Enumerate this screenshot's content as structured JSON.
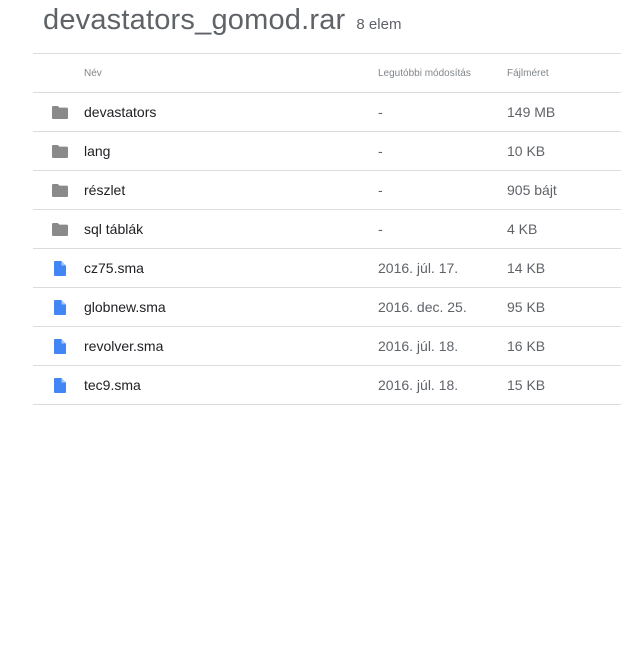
{
  "header": {
    "title": "devastators_gomod.rar",
    "count": "8 elem"
  },
  "columns": {
    "name": "Név",
    "modified": "Legutóbbi módosítás",
    "size": "Fájlméret"
  },
  "colors": {
    "folder_icon": "#8a8a8a",
    "file_icon": "#4285f4",
    "divider": "#dadce0"
  },
  "rows": [
    {
      "type": "folder",
      "icon": "folder-icon",
      "name": "devastators",
      "modified": "-",
      "size": "149 MB"
    },
    {
      "type": "folder",
      "icon": "folder-icon",
      "name": "lang",
      "modified": "-",
      "size": "10 KB"
    },
    {
      "type": "folder",
      "icon": "folder-icon",
      "name": "részlet",
      "modified": "-",
      "size": "905 bájt"
    },
    {
      "type": "folder",
      "icon": "folder-icon",
      "name": "sql táblák",
      "modified": "-",
      "size": "4 KB"
    },
    {
      "type": "file",
      "icon": "file-icon",
      "name": "cz75.sma",
      "modified": "2016. júl. 17.",
      "size": "14 KB"
    },
    {
      "type": "file",
      "icon": "file-icon",
      "name": "globnew.sma",
      "modified": "2016. dec. 25.",
      "size": "95 KB"
    },
    {
      "type": "file",
      "icon": "file-icon",
      "name": "revolver.sma",
      "modified": "2016. júl. 18.",
      "size": "16 KB"
    },
    {
      "type": "file",
      "icon": "file-icon",
      "name": "tec9.sma",
      "modified": "2016. júl. 18.",
      "size": "15 KB"
    }
  ]
}
